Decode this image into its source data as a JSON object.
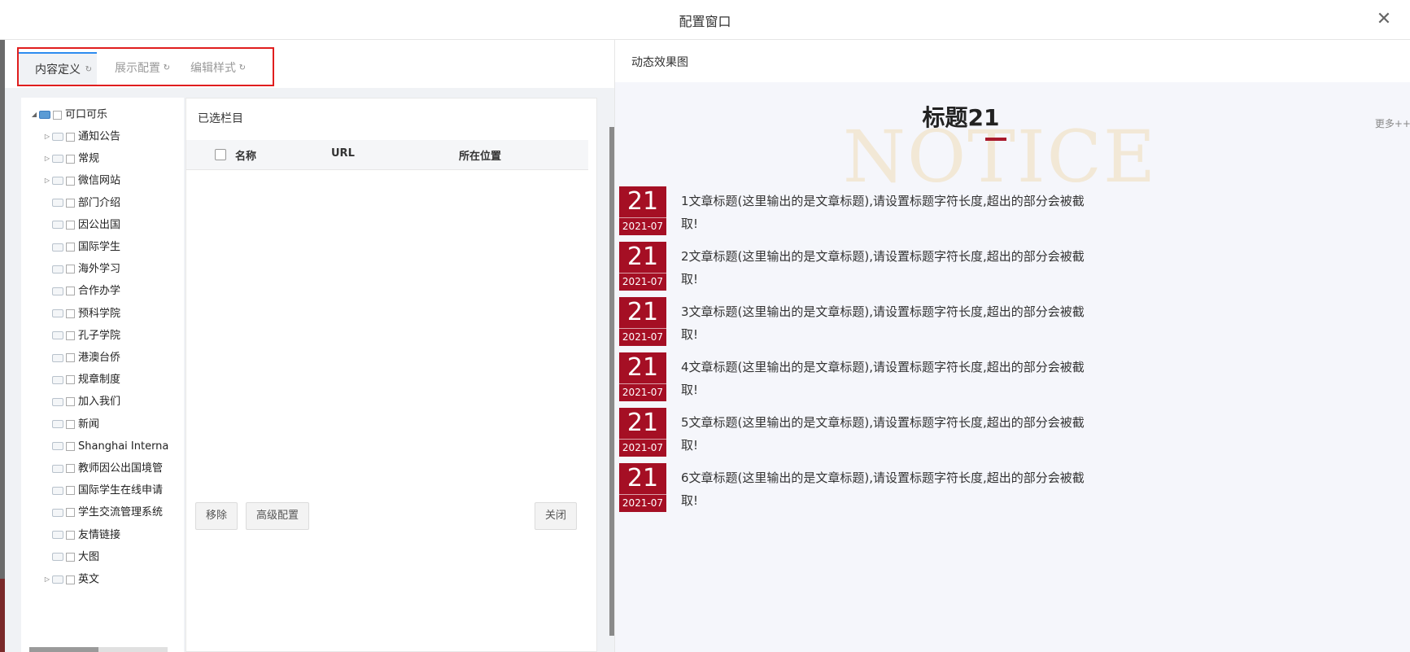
{
  "window": {
    "title": "配置窗口",
    "close_glyph": "✕"
  },
  "tabs": [
    {
      "label": "内容定义",
      "active": true
    },
    {
      "label": "展示配置",
      "active": false
    },
    {
      "label": "编辑样式",
      "active": false
    }
  ],
  "tab_refresh_glyph": "↻",
  "tree": {
    "root": "可口可乐",
    "items": [
      {
        "label": "通知公告",
        "expandable": true
      },
      {
        "label": "常规",
        "expandable": true
      },
      {
        "label": "微信网站",
        "expandable": true
      },
      {
        "label": "部门介绍",
        "expandable": false
      },
      {
        "label": "因公出国",
        "expandable": false
      },
      {
        "label": "国际学生",
        "expandable": false
      },
      {
        "label": "海外学习",
        "expandable": false
      },
      {
        "label": "合作办学",
        "expandable": false
      },
      {
        "label": "预科学院",
        "expandable": false
      },
      {
        "label": "孔子学院",
        "expandable": false
      },
      {
        "label": "港澳台侨",
        "expandable": false
      },
      {
        "label": "规章制度",
        "expandable": false
      },
      {
        "label": "加入我们",
        "expandable": false
      },
      {
        "label": "新闻",
        "expandable": false
      },
      {
        "label": "Shanghai Interna",
        "expandable": false
      },
      {
        "label": "教师因公出国境管",
        "expandable": false
      },
      {
        "label": "国际学生在线申请",
        "expandable": false
      },
      {
        "label": "学生交流管理系统",
        "expandable": false
      },
      {
        "label": "友情链接",
        "expandable": false
      },
      {
        "label": "大图",
        "expandable": false
      },
      {
        "label": "英文",
        "expandable": true
      }
    ]
  },
  "selected": {
    "title": "已选栏目",
    "columns": [
      "名称",
      "URL",
      "所在位置"
    ],
    "buttons": {
      "remove": "移除",
      "advanced": "高级配置",
      "close": "关闭"
    }
  },
  "preview": {
    "header": "动态效果图",
    "title": "标题21",
    "watermark": "NOTICE",
    "more": "更多++",
    "accent_color": "#a50f24",
    "news": [
      {
        "day": "21",
        "ym": "2021-07",
        "text": "1文章标题(这里输出的是文章标题),请设置标题字符长度,超出的部分会被截取!"
      },
      {
        "day": "21",
        "ym": "2021-07",
        "text": "2文章标题(这里输出的是文章标题),请设置标题字符长度,超出的部分会被截取!"
      },
      {
        "day": "21",
        "ym": "2021-07",
        "text": "3文章标题(这里输出的是文章标题),请设置标题字符长度,超出的部分会被截取!"
      },
      {
        "day": "21",
        "ym": "2021-07",
        "text": "4文章标题(这里输出的是文章标题),请设置标题字符长度,超出的部分会被截取!"
      },
      {
        "day": "21",
        "ym": "2021-07",
        "text": "5文章标题(这里输出的是文章标题),请设置标题字符长度,超出的部分会被截取!"
      },
      {
        "day": "21",
        "ym": "2021-07",
        "text": "6文章标题(这里输出的是文章标题),请设置标题字符长度,超出的部分会被截取!"
      }
    ]
  }
}
